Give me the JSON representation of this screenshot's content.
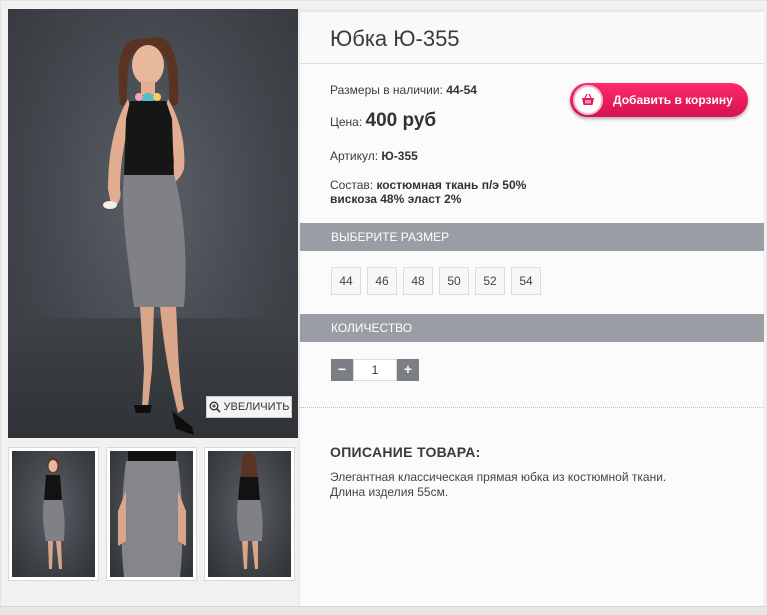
{
  "product": {
    "title": "Юбка Ю-355",
    "sizes_label": "Размеры в наличии:",
    "sizes_value": "44-54",
    "price_label": "Цена:",
    "price_value": "400 руб",
    "article_label": "Артикул:",
    "article_value": "Ю-355",
    "composition_label": "Состав:",
    "composition_line1": "костюмная ткань п/э 50%",
    "composition_line2": "вискоза 48% эласт 2%"
  },
  "cart": {
    "label": "Добавить в корзину",
    "icon": "basket-icon"
  },
  "zoom": {
    "label": "УВЕЛИЧИТЬ",
    "icon": "zoom-in-icon"
  },
  "size_section": {
    "title": "ВЫБЕРИТЕ РАЗМЕР",
    "sizes": [
      "44",
      "46",
      "48",
      "50",
      "52",
      "54"
    ]
  },
  "quantity_section": {
    "title": "КОЛИЧЕСТВО",
    "minus": "−",
    "value": "1",
    "plus": "+"
  },
  "description": {
    "heading": "ОПИСАНИЕ ТОВАРА:",
    "line1": "Элегантная классическая прямая юбка из костюмной ткани.",
    "line2": "Длина изделия 55см."
  },
  "colors": {
    "cart_button": "#e8185a",
    "section_bar": "#9a9ea4",
    "qty_button": "#7b7e83"
  }
}
